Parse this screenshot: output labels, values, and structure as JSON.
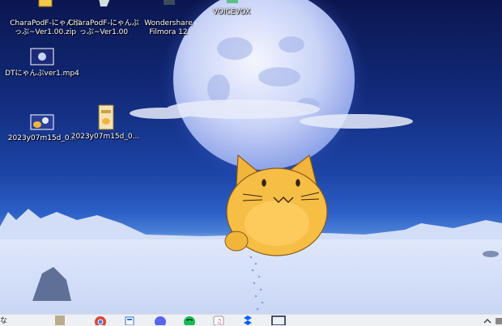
{
  "desktop": {
    "icons": [
      {
        "label1": "CharaPodF-にゃんぷ",
        "label2": "っぷ~Ver1.00.zip",
        "icon": "zip-archive-icon"
      },
      {
        "label1": "CharaPodF-にゃんぷ",
        "label2": "っぷ~Ver1.00",
        "icon": "app-folder-icon"
      },
      {
        "label1": "Wondershare",
        "label2": "Filmora 12",
        "icon": "filmora-app-icon"
      },
      {
        "label1": "VOICEVOX",
        "label2": "",
        "icon": "voicevox-app-icon"
      },
      {
        "label1": "DTにゃんぷver1.mp4",
        "label2": "",
        "icon": "video-file-icon"
      },
      {
        "label1": "2023y07m15d_0...",
        "label2": "",
        "icon": "image-file-icon"
      },
      {
        "label1": "2023y07m15d_0...",
        "label2": "",
        "icon": "image-file-icon"
      }
    ]
  },
  "taskbar": {
    "left_text": "な",
    "apps": [
      "explorer-icon",
      "chrome-icon",
      "notepad-icon",
      "discord-icon",
      "spotify-icon",
      "itunes-icon",
      "dropbox-icon",
      "window-icon"
    ],
    "colors": {
      "chrome": "#db4437",
      "discord": "#5865f2",
      "spotify": "#1db954",
      "dropbox": "#0061fe"
    }
  }
}
